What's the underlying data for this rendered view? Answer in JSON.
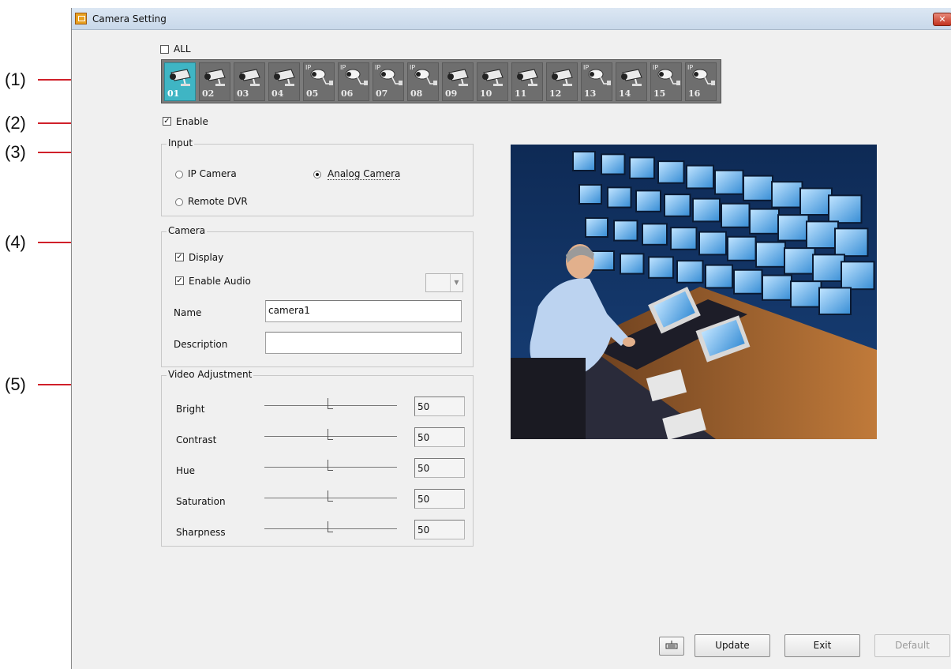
{
  "callouts": [
    "(1)",
    "(2)",
    "(3)",
    "(4)",
    "(5)"
  ],
  "window": {
    "title": "Camera Setting",
    "close_glyph": "✕"
  },
  "all_checkbox": {
    "label": "ALL",
    "checked": false
  },
  "cameras": [
    {
      "num": "01",
      "ip": false,
      "selected": true
    },
    {
      "num": "02",
      "ip": false,
      "selected": false
    },
    {
      "num": "03",
      "ip": false,
      "selected": false
    },
    {
      "num": "04",
      "ip": false,
      "selected": false
    },
    {
      "num": "05",
      "ip": true,
      "selected": false
    },
    {
      "num": "06",
      "ip": true,
      "selected": false
    },
    {
      "num": "07",
      "ip": true,
      "selected": false
    },
    {
      "num": "08",
      "ip": true,
      "selected": false
    },
    {
      "num": "09",
      "ip": false,
      "selected": false
    },
    {
      "num": "10",
      "ip": false,
      "selected": false
    },
    {
      "num": "11",
      "ip": false,
      "selected": false
    },
    {
      "num": "12",
      "ip": false,
      "selected": false
    },
    {
      "num": "13",
      "ip": true,
      "selected": false
    },
    {
      "num": "14",
      "ip": false,
      "selected": false
    },
    {
      "num": "15",
      "ip": true,
      "selected": false
    },
    {
      "num": "16",
      "ip": true,
      "selected": false
    }
  ],
  "ip_tag": "IP",
  "enable_checkbox": {
    "label": "Enable",
    "checked": true
  },
  "input_group": {
    "title": "Input",
    "options": {
      "ip_camera": "IP Camera",
      "analog_camera": "Analog Camera",
      "remote_dvr": "Remote DVR"
    },
    "selected": "analog_camera"
  },
  "camera_group": {
    "title": "Camera",
    "display_label": "Display",
    "display_checked": true,
    "enable_audio_label": "Enable Audio",
    "enable_audio_checked": true,
    "name_label": "Name",
    "name_value": "camera1",
    "description_label": "Description",
    "description_value": ""
  },
  "video_group": {
    "title": "Video Adjustment",
    "rows": [
      {
        "label": "Bright",
        "value": "50",
        "level": 0.5
      },
      {
        "label": "Contrast",
        "value": "50",
        "level": 0.5
      },
      {
        "label": "Hue",
        "value": "50",
        "level": 0.5
      },
      {
        "label": "Saturation",
        "value": "50",
        "level": 0.5
      },
      {
        "label": "Sharpness",
        "value": "50",
        "level": 0.5
      }
    ]
  },
  "buttons": {
    "update": "Update",
    "exit": "Exit",
    "default": "Default",
    "keyboard_icon": "keyboard-icon"
  },
  "colors": {
    "callout_line": "#d0202a",
    "selected_camera": "#3fb5c4",
    "camera_strip": "#7b7b7b"
  }
}
